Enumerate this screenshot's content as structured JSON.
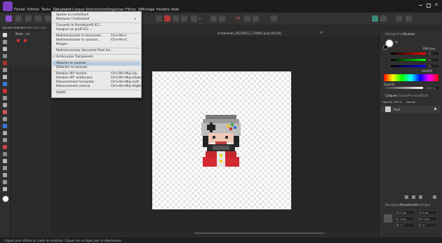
{
  "menubar": {
    "items": [
      "Fichier",
      "Edition",
      "Texte",
      "Document",
      "Calque",
      "Sélectionner",
      "Organiser",
      "Filtres",
      "Affichage",
      "Fenêtre",
      "Aide"
    ],
    "zoom_value": "75"
  },
  "context": {
    "left_label": "Aucune sélection",
    "left_label2": "Sélection auto",
    "layer_mode": "Mode",
    "layer_mode_value": "cal"
  },
  "document": {
    "tab_title": "screenshot_20230522_170002.png (56.6%)"
  },
  "menu": {
    "items": [
      {
        "label": "Ajuster en instantané",
        "shortcut": ""
      },
      {
        "label": "Restaurer l'instantané",
        "shortcut": ""
      },
      {
        "label": "Convertir le format/profil ICC...",
        "shortcut": ""
      },
      {
        "label": "Assigner un profil ICC...",
        "shortcut": ""
      },
      {
        "label": "Redimensionner le document...",
        "shortcut": "Ctrl+Alt+I"
      },
      {
        "label": "Redimensionner le canevas...",
        "shortcut": "Ctrl+Alt+C"
      },
      {
        "label": "Marges...",
        "shortcut": ""
      },
      {
        "label": "Redimensionner document Pixel Art...",
        "shortcut": ""
      },
      {
        "label": "Arrière-plan Transparent",
        "shortcut": ""
      },
      {
        "label": "Attacher le canevas",
        "shortcut": ""
      },
      {
        "label": "Détacher le canevas",
        "shortcut": ""
      },
      {
        "label": "Rotation 90° horaire",
        "shortcut": "Ctrl+Alt+Maj+Up"
      },
      {
        "label": "Rotation 90° antihoraire",
        "shortcut": "Ctrl+Alt+Maj+Down"
      },
      {
        "label": "Retournement horizontal",
        "shortcut": "Ctrl+Alt+Maj+Left"
      },
      {
        "label": "Retournement vertical",
        "shortcut": "Ctrl+Alt+Maj+Right"
      },
      {
        "label": "Aplatir",
        "shortcut": ""
      }
    ],
    "checked_item": "Arrière-plan Transparent",
    "highlighted_item": "Attacher le canevas"
  },
  "right_panel": {
    "tabs_top": [
      "Histogramme",
      "Couleur"
    ],
    "color_mode": "RVB Hex",
    "r": "0",
    "g": "0",
    "b": "0",
    "hex": "000000",
    "opacity_label": "Opacité",
    "opacity_value": "100 %",
    "tabs_mid": [
      "Calques",
      "Canaux",
      "Pinceaux",
      "Stock"
    ],
    "blend_label": "Opacité",
    "blend_opacity": "100 %",
    "blend_mode": "Normal",
    "layer_name": "Pixel",
    "tabs_bottom": [
      "Navigateur",
      "Transformer",
      "Historique"
    ],
    "transform_fields": [
      "X: 0 px",
      "Y: 0 px",
      "L: 0 px",
      "H: 0 px",
      "R: 0 °",
      "S: 0 °"
    ]
  },
  "status": {
    "text": "Cliquer pour utiliser un cadre de sélection. Cliquer sur un objet pour le sélectionner."
  },
  "colors": {
    "accent": "#3d7ec9",
    "menu_bg": "#e9e9e9",
    "highlight": "#b8cce0"
  }
}
